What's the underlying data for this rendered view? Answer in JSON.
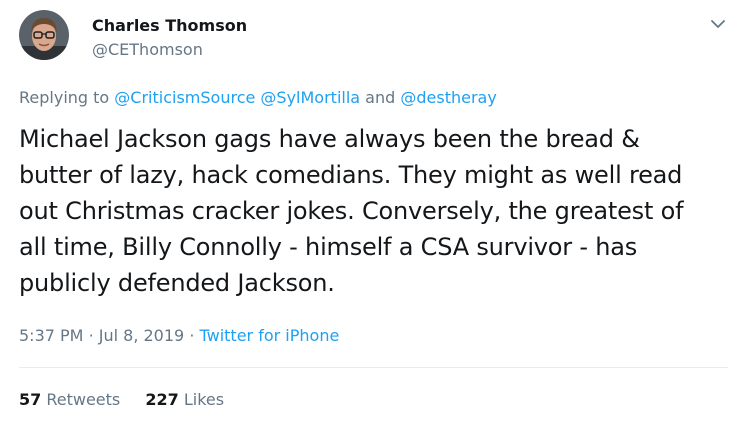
{
  "author": {
    "name": "Charles Thomson",
    "handle": "@CEThomson"
  },
  "reply": {
    "prefix": "Replying to",
    "users": [
      "@CriticismSource",
      "@SylMortilla",
      "@destheray"
    ],
    "conjunction": "and"
  },
  "tweet": {
    "lines": [
      "Michael Jackson gags have always been the bread &",
      "butter of lazy, hack comedians. They might as well read",
      "out Christmas cracker jokes. Conversely, the greatest of",
      "all time, Billy Connolly - himself a CSA survivor - has",
      "publicly defended Jackson."
    ]
  },
  "meta": {
    "time": "5:37 PM",
    "date": "Jul 8, 2019",
    "separator": "·",
    "source": "Twitter for iPhone"
  },
  "stats": {
    "retweets_count": "57",
    "retweets_label": "Retweets",
    "likes_count": "227",
    "likes_label": "Likes"
  },
  "icons": {
    "menu": "chevron-down-icon"
  },
  "colors": {
    "link": "#1da1f2",
    "secondary_text": "#657786",
    "primary_text": "#14171a",
    "divider": "#e6ecf0"
  }
}
